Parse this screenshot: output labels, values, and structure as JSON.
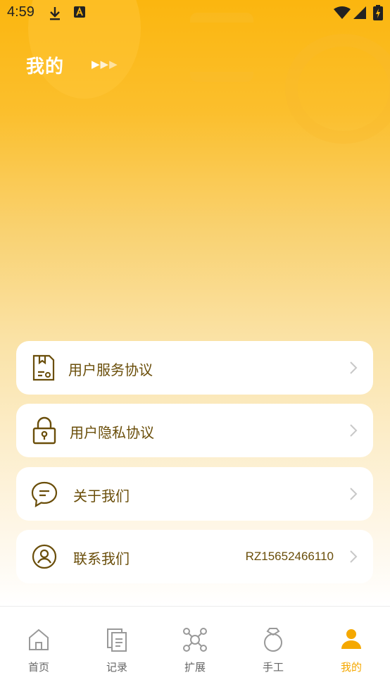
{
  "status_bar": {
    "time": "4:59"
  },
  "header": {
    "title": "我的"
  },
  "menu": [
    {
      "label": "用户服务协议",
      "value": ""
    },
    {
      "label": "用户隐私协议",
      "value": ""
    },
    {
      "label": "关于我们",
      "value": ""
    },
    {
      "label": "联系我们",
      "value": "RZ15652466110"
    }
  ],
  "tabs": [
    {
      "label": "首页",
      "icon": "home-icon",
      "active": false
    },
    {
      "label": "记录",
      "icon": "records-icon",
      "active": false
    },
    {
      "label": "扩展",
      "icon": "extension-icon",
      "active": false
    },
    {
      "label": "手工",
      "icon": "ring-icon",
      "active": false
    },
    {
      "label": "我的",
      "icon": "person-icon",
      "active": true
    }
  ],
  "colors": {
    "accent": "#f5a800",
    "text_brown": "#6a4e0a",
    "header_top": "#fbb60f"
  }
}
